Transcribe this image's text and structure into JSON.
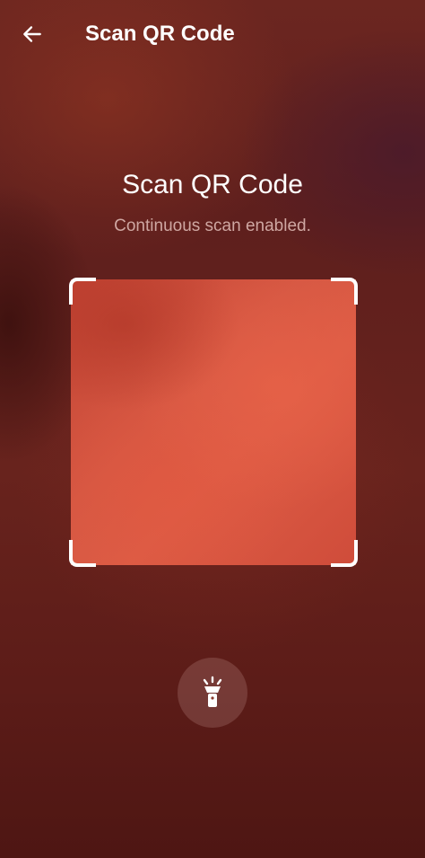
{
  "app_bar": {
    "title": "Scan QR Code",
    "back_icon": "arrow-left-icon"
  },
  "content": {
    "heading": "Scan QR Code",
    "subtitle": "Continuous scan enabled."
  },
  "scanner": {
    "frame_corner_color": "#ffffff",
    "viewfinder_color": "#d65843"
  },
  "actions": {
    "flashlight_icon": "flashlight-icon"
  },
  "colors": {
    "background": "#5e1f1d",
    "title_text": "#ffffff",
    "subtitle_text": "#cfa7a2"
  }
}
